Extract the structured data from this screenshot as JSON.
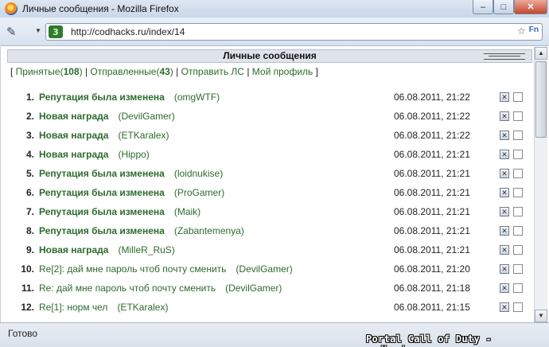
{
  "window": {
    "title": "Личные сообщения - Mozilla Firefox",
    "minimize": "–",
    "maximize": "□",
    "close": "✕"
  },
  "nav": {
    "url": "http://codhacks.ru/index/14",
    "site_icon_text": "3"
  },
  "page": {
    "header": "Личные сообщения",
    "links": {
      "open": "[ ",
      "inbox_label": "Принятые",
      "inbox_count": "108",
      "sep1": " | ",
      "sent_label": "Отправленные",
      "sent_count": "43",
      "sep2": " | ",
      "send": "Отправить ЛС",
      "sep3": " | ",
      "profile": "Мой профиль",
      "close": " ]"
    },
    "messages": [
      {
        "num": "1.",
        "subject": "Репутация была изменена",
        "author": "(omgWTF)",
        "date": "06.08.2011, 21:22",
        "unread": true
      },
      {
        "num": "2.",
        "subject": "Новая награда",
        "author": "(DevilGamer)",
        "date": "06.08.2011, 21:22",
        "unread": true
      },
      {
        "num": "3.",
        "subject": "Новая награда",
        "author": "(ETKaralex)",
        "date": "06.08.2011, 21:22",
        "unread": true
      },
      {
        "num": "4.",
        "subject": "Новая награда",
        "author": "(Hippo)",
        "date": "06.08.2011, 21:21",
        "unread": true
      },
      {
        "num": "5.",
        "subject": "Репутация была изменена",
        "author": "(loidnukise)",
        "date": "06.08.2011, 21:21",
        "unread": true
      },
      {
        "num": "6.",
        "subject": "Репутация была изменена",
        "author": "(ProGamer)",
        "date": "06.08.2011, 21:21",
        "unread": true
      },
      {
        "num": "7.",
        "subject": "Репутация была изменена",
        "author": "(Maik)",
        "date": "06.08.2011, 21:21",
        "unread": true
      },
      {
        "num": "8.",
        "subject": "Репутация была изменена",
        "author": "(Zabantemenya)",
        "date": "06.08.2011, 21:21",
        "unread": true
      },
      {
        "num": "9.",
        "subject": "Новая награда",
        "author": "(MilleR_RuS)",
        "date": "06.08.2011, 21:21",
        "unread": true
      },
      {
        "num": "10.",
        "subject": "Re[2]: дай мне пароль чтоб почту сменить",
        "author": "(DevilGamer)",
        "date": "06.08.2011, 21:20",
        "unread": false
      },
      {
        "num": "11.",
        "subject": "Re: дай мне пароль чтоб почту сменить",
        "author": "(DevilGamer)",
        "date": "06.08.2011, 21:18",
        "unread": false
      },
      {
        "num": "12.",
        "subject": "Re[1]: норм чел",
        "author": "(ETKaralex)",
        "date": "06.08.2011, 21:15",
        "unread": false
      }
    ]
  },
  "status": {
    "text": "Готово",
    "watermark": "Portal Call of Duty - codhacks.ru"
  }
}
